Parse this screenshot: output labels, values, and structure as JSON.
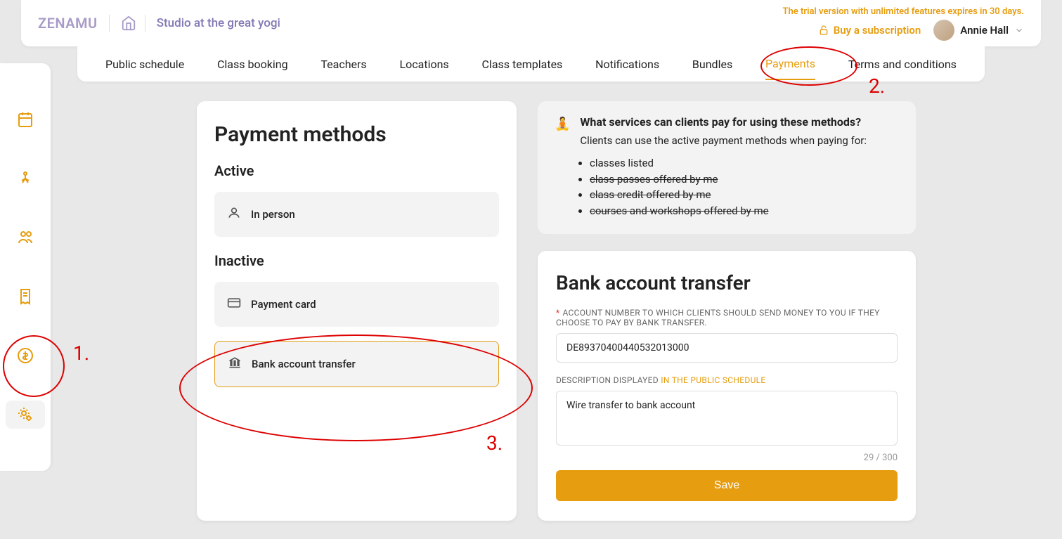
{
  "header": {
    "logo": "ZENAMU",
    "studio_name": "Studio at the great yogi",
    "trial_text": "The trial version with unlimited features expires in 30 days.",
    "subscribe_label": "Buy a subscription",
    "user_name": "Annie Hall"
  },
  "tabs": [
    {
      "label": "Public schedule",
      "active": false
    },
    {
      "label": "Class booking",
      "active": false
    },
    {
      "label": "Teachers",
      "active": false
    },
    {
      "label": "Locations",
      "active": false
    },
    {
      "label": "Class templates",
      "active": false
    },
    {
      "label": "Notifications",
      "active": false
    },
    {
      "label": "Bundles",
      "active": false
    },
    {
      "label": "Payments",
      "active": true
    },
    {
      "label": "Terms and conditions",
      "active": false
    }
  ],
  "sidebar": {
    "items": [
      "calendar",
      "yoga",
      "people",
      "receipt",
      "dollar",
      "settings"
    ]
  },
  "payment_methods": {
    "title": "Payment methods",
    "active_label": "Active",
    "inactive_label": "Inactive",
    "active": [
      {
        "icon": "person",
        "label": "In person"
      }
    ],
    "inactive": [
      {
        "icon": "card",
        "label": "Payment card",
        "selected": false
      },
      {
        "icon": "bank",
        "label": "Bank account transfer",
        "selected": true
      }
    ]
  },
  "info": {
    "emoji": "🧘",
    "title": "What services can clients pay for using these methods?",
    "subtitle": "Clients can use the active payment methods when paying for:",
    "items": [
      {
        "text": "classes listed",
        "struck": false
      },
      {
        "text": "class passes offered by me",
        "struck": true
      },
      {
        "text": "class credit offered by me",
        "struck": true
      },
      {
        "text": "courses and workshops offered by me",
        "struck": true
      }
    ]
  },
  "form": {
    "title": "Bank account transfer",
    "account_label": "ACCOUNT NUMBER TO WHICH CLIENTS SHOULD SEND MONEY TO YOU IF THEY CHOOSE TO PAY BY BANK TRANSFER.",
    "account_value": "DE89370400440532013000",
    "description_label": "DESCRIPTION DISPLAYED ",
    "description_suffix": "IN THE PUBLIC SCHEDULE",
    "description_value": "Wire transfer to bank account",
    "char_count": "29 / 300",
    "save_label": "Save"
  },
  "annotations": {
    "n1": "1.",
    "n2": "2.",
    "n3": "3."
  }
}
